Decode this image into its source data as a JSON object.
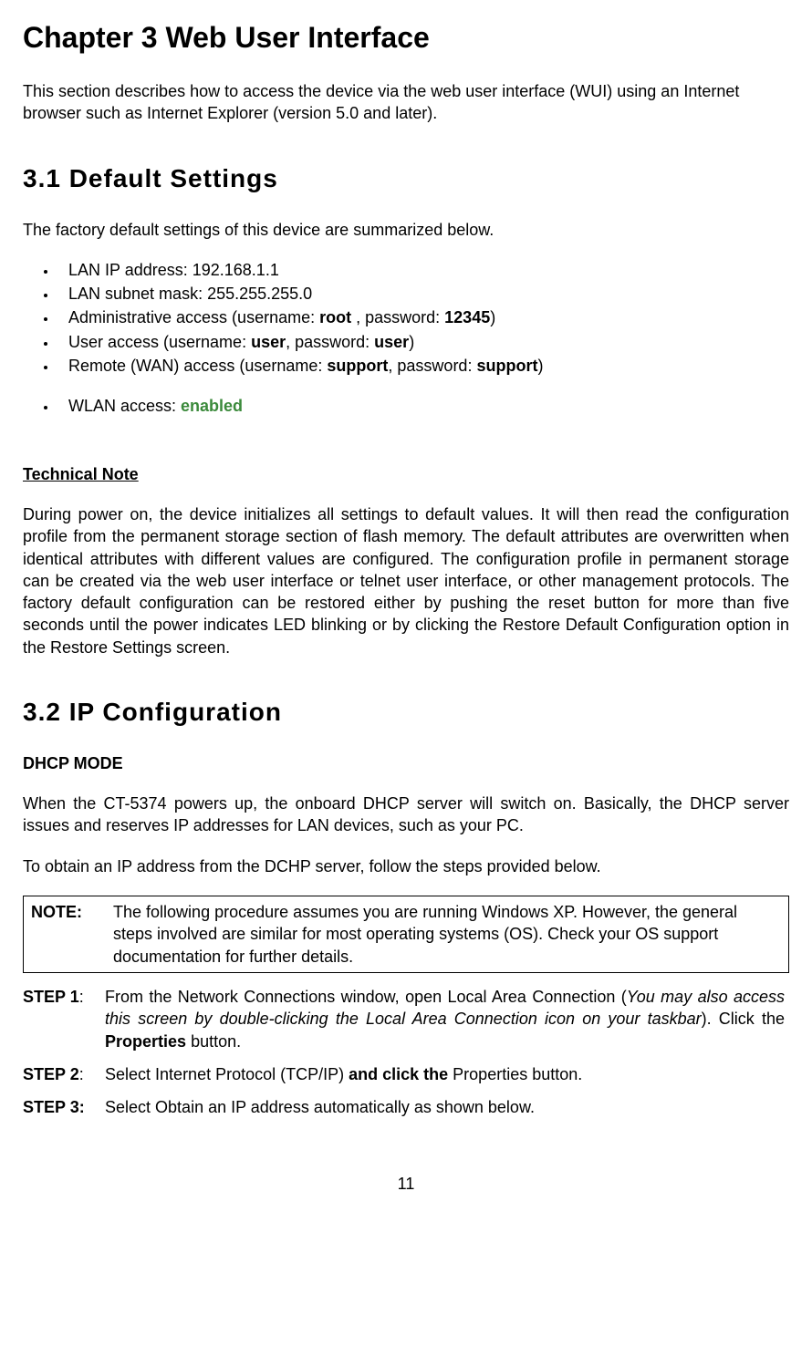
{
  "chapter_title": "Chapter 3 Web User Interface",
  "intro": "This section describes how to access the device via the web user interface (WUI) using an Internet browser such as Internet Explorer (version 5.0 and later).",
  "section_3_1": {
    "heading": "3.1 Default Settings",
    "intro": "The factory default settings of this device are summarized below.",
    "bullets": {
      "lan_ip": "LAN IP address: 192.168.1.1",
      "subnet": "LAN subnet mask: 255.255.255.0",
      "admin_pre": "Administrative access (username: ",
      "admin_user": "root",
      "admin_mid": " , password: ",
      "admin_pass": "12345",
      "admin_end": ")",
      "user_pre": "User access (username: ",
      "user_user": "user",
      "user_mid": ", password: ",
      "user_pass": "user",
      "user_end": ")",
      "remote_pre": "Remote (WAN) access (username: ",
      "remote_user": "support",
      "remote_mid": ", password: ",
      "remote_pass": "support",
      "remote_end": ")",
      "wlan_pre": "WLAN access: ",
      "wlan_val": "enabled"
    }
  },
  "tech_note": {
    "heading": "Technical Note",
    "body": "During power on, the device initializes all settings to default values.  It will then read the configuration profile from the permanent storage section of flash memory. The default attributes are overwritten when identical attributes with different values are configured.  The configuration profile in permanent storage can be created via the web user interface or telnet user interface, or other management protocols. The factory default configuration can be restored either by pushing the reset button for more than five seconds until the power indicates LED blinking or by clicking the Restore Default Configuration option in the Restore Settings screen."
  },
  "section_3_2": {
    "heading": "3.2 IP Configuration",
    "subheading": "DHCP MODE",
    "para1": "When the CT-5374 powers up, the onboard DHCP server will switch on. Basically, the DHCP server issues and reserves IP addresses for LAN devices, such as your PC.",
    "para2": "To obtain an IP address from the DCHP server, follow the steps provided below.",
    "note_label": "NOTE:",
    "note_text": "The following procedure assumes you are running Windows XP. However, the general steps involved are similar for most operating systems (OS). Check your OS support documentation for further details.",
    "step1_label": "STEP 1",
    "step1_colon": ":",
    "step1_a": "From the Network Connections window, open Local Area Connection (",
    "step1_italic": "You may also access this screen by double-clicking the Local Area Connection icon on your taskbar",
    "step1_b": "). Click the ",
    "step1_bold": "Properties",
    "step1_c": " button.",
    "step2_label": "STEP 2",
    "step2_colon": ":",
    "step2_a": "Select Internet Protocol (TCP/IP) ",
    "step2_bold": "and click the",
    "step2_b": " Properties button.",
    "step3_label": "STEP 3:",
    "step3_text": "Select Obtain an IP address automatically as shown below."
  },
  "page_number": "11"
}
